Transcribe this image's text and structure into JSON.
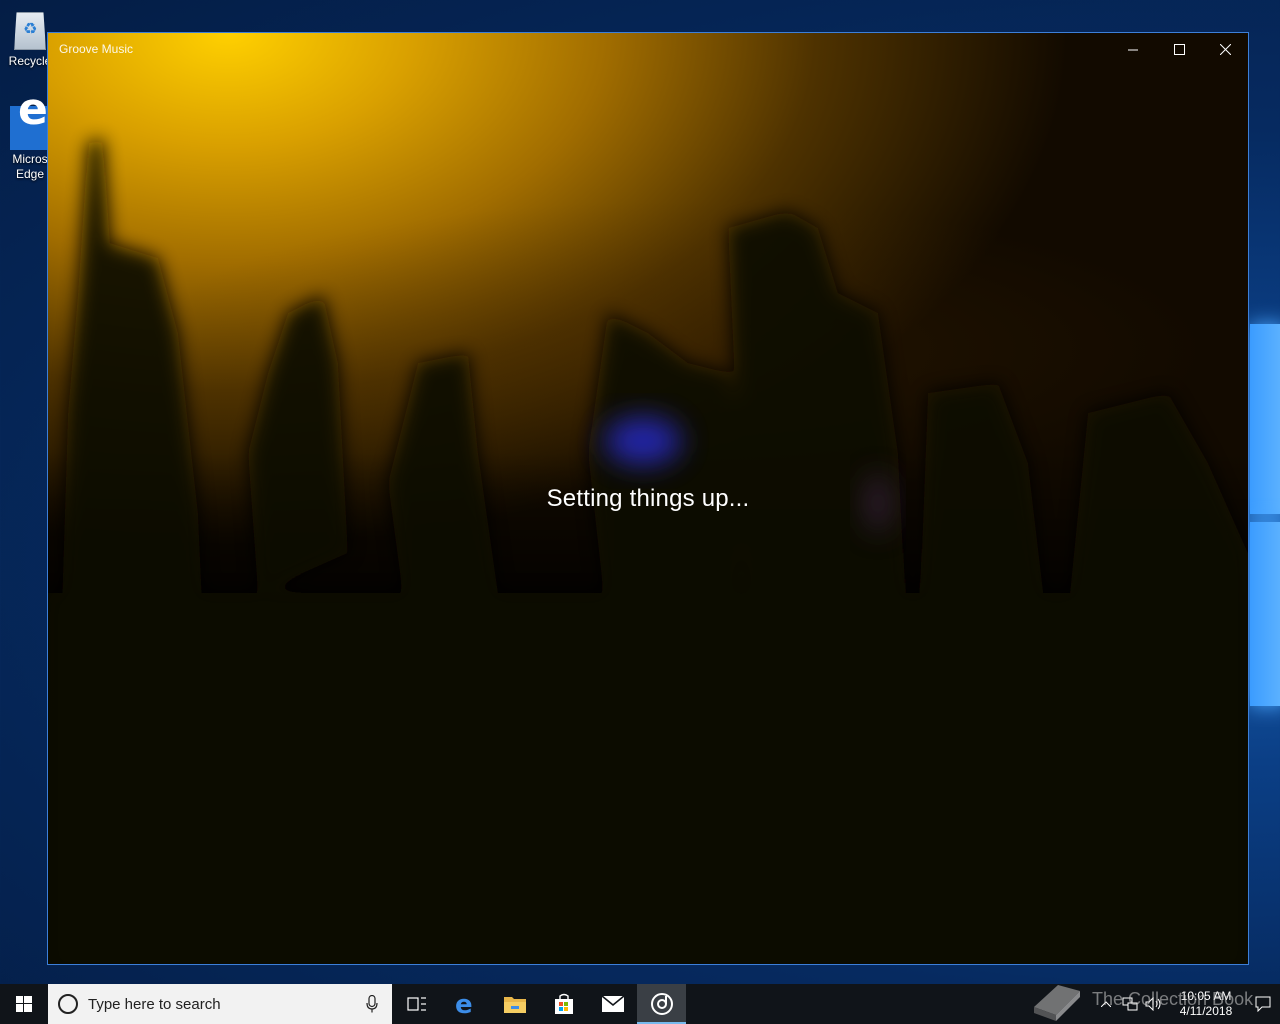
{
  "desktop": {
    "icons": [
      {
        "label": "Recycle"
      },
      {
        "label": "Micros\nEdge"
      }
    ]
  },
  "window": {
    "title": "Groove Music",
    "status": "Setting things up...",
    "controls": {
      "minimize": "minimize-icon",
      "maximize": "maximize-icon",
      "close": "close-icon"
    }
  },
  "taskbar": {
    "search_placeholder": "Type here to search",
    "apps": [
      "task-view-icon",
      "edge-icon",
      "file-explorer-icon",
      "store-icon",
      "mail-icon",
      "groove-music-icon"
    ],
    "active_app": "groove-music-icon",
    "clock_time": "10:05 AM",
    "clock_date": "4/11/2018"
  },
  "watermark": {
    "text": "The Collection Book"
  },
  "colors": {
    "accent": "#3c7fd9",
    "taskbar": "#101419",
    "active_indicator": "#76b9ed"
  }
}
